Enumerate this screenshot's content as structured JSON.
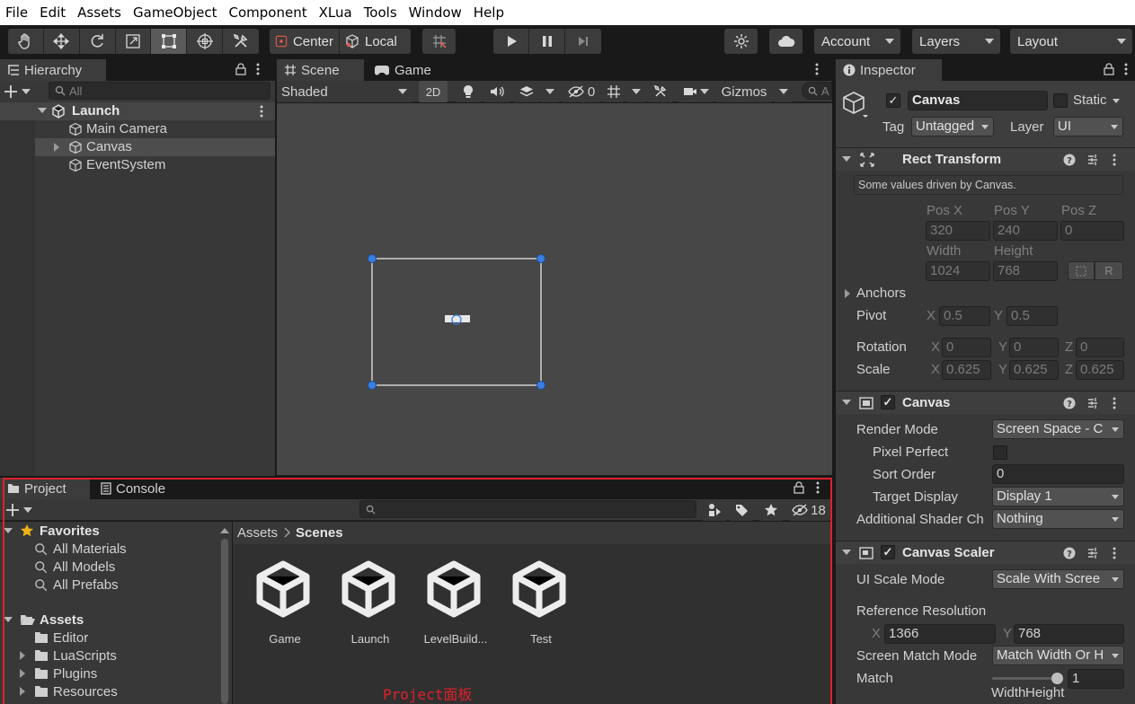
{
  "menu": [
    "File",
    "Edit",
    "Assets",
    "GameObject",
    "Component",
    "XLua",
    "Tools",
    "Window",
    "Help"
  ],
  "toolbar": {
    "pivot_mode": "Center",
    "pivot_rotation": "Local",
    "account": "Account",
    "layers": "Layers",
    "layout": "Layout"
  },
  "hierarchy": {
    "tab": "Hierarchy",
    "search_placeholder": "All",
    "scene": "Launch",
    "items": [
      "Main Camera",
      "Canvas",
      "EventSystem"
    ]
  },
  "scene_view": {
    "tabs": [
      "Scene",
      "Game"
    ],
    "draw_mode": "Shaded",
    "mode_2d": "2D",
    "hidden_count": "0",
    "gizmos": "Gizmos",
    "search_placeholder": "A"
  },
  "inspector": {
    "tab": "Inspector",
    "object_name": "Canvas",
    "static_label": "Static",
    "tag_label": "Tag",
    "tag_value": "Untagged",
    "layer_label": "Layer",
    "layer_value": "UI",
    "rect_transform": {
      "title": "Rect Transform",
      "note": "Some values driven by Canvas.",
      "pos_x_label": "Pos X",
      "pos_y_label": "Pos Y",
      "pos_z_label": "Pos Z",
      "pos_x": "320",
      "pos_y": "240",
      "pos_z": "0",
      "width_label": "Width",
      "height_label": "Height",
      "width": "1024",
      "height": "768",
      "r_button": "R",
      "anchors": "Anchors",
      "pivot_label": "Pivot",
      "pivot_x": "0.5",
      "pivot_y": "0.5",
      "rotation_label": "Rotation",
      "rot_x": "0",
      "rot_y": "0",
      "rot_z": "0",
      "scale_label": "Scale",
      "scale_x": "0.625",
      "scale_y": "0.625",
      "scale_z": "0.625",
      "x": "X",
      "y": "Y",
      "z": "Z"
    },
    "canvas": {
      "title": "Canvas",
      "render_mode_label": "Render Mode",
      "render_mode": "Screen Space - C",
      "pixel_perfect_label": "Pixel Perfect",
      "sort_order_label": "Sort Order",
      "sort_order": "0",
      "target_display_label": "Target Display",
      "target_display": "Display 1",
      "shader_label": "Additional Shader Ch",
      "shader_value": "Nothing"
    },
    "canvas_scaler": {
      "title": "Canvas Scaler",
      "ui_scale_mode_label": "UI Scale Mode",
      "ui_scale_mode": "Scale With Scree",
      "ref_res_label": "Reference Resolution",
      "ref_x": "1366",
      "ref_y": "768",
      "match_mode_label": "Screen Match Mode",
      "match_mode": "Match Width Or H",
      "match_label": "Match",
      "match_value": "1",
      "match_fraction": 1.0,
      "width_label": "Width",
      "height_label": "Height"
    }
  },
  "project": {
    "tabs": [
      "Project",
      "Console"
    ],
    "hidden_count": "18",
    "favorites": "Favorites",
    "favorite_items": [
      "All Materials",
      "All Models",
      "All Prefabs"
    ],
    "assets": "Assets",
    "folders": [
      "Editor",
      "LuaScripts",
      "Plugins",
      "Resources"
    ],
    "breadcrumb_root": "Assets",
    "breadcrumb_current": "Scenes",
    "scene_files": [
      "Game",
      "Launch",
      "LevelBuild...",
      "Test"
    ],
    "annotation": "Project面板"
  },
  "colors": {
    "annotation_red": "#e0202a",
    "handle_blue": "#3a7fe0",
    "panel": "#383838",
    "header": "#3e3e3e"
  }
}
